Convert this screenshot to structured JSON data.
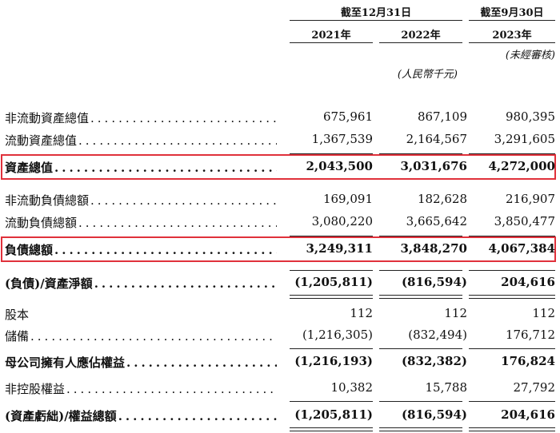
{
  "header": {
    "group_a": "截至12月31日",
    "group_b": "截至9月30日",
    "years": [
      "2021年",
      "2022年",
      "2023年"
    ],
    "unaudited": "(未經審核)",
    "unit": "(人民幣千元)"
  },
  "rows": [
    {
      "label": "非流動資產總值",
      "v": [
        "675,961",
        "867,109",
        "980,395"
      ]
    },
    {
      "label": "流動資產總值",
      "v": [
        "1,367,539",
        "2,164,567",
        "3,291,605"
      ]
    },
    {
      "label": "資產總值",
      "v": [
        "2,043,500",
        "3,031,676",
        "4,272,000"
      ]
    },
    {
      "label": "非流動負債總額",
      "v": [
        "169,091",
        "182,628",
        "216,907"
      ]
    },
    {
      "label": "流動負債總額",
      "v": [
        "3,080,220",
        "3,665,642",
        "3,850,477"
      ]
    },
    {
      "label": "負債總額",
      "v": [
        "3,249,311",
        "3,848,270",
        "4,067,384"
      ]
    },
    {
      "label": "(負債)/資產淨額",
      "v": [
        "(1,205,811)",
        "(816,594)",
        "204,616"
      ]
    },
    {
      "label": "股本",
      "v": [
        "112",
        "112",
        "112"
      ]
    },
    {
      "label": "儲備",
      "v": [
        "(1,216,305)",
        "(832,494)",
        "176,712"
      ]
    },
    {
      "label": "母公司擁有人應佔權益",
      "v": [
        "(1,216,193)",
        "(832,382)",
        "176,824"
      ]
    },
    {
      "label": "非控股權益",
      "v": [
        "10,382",
        "15,788",
        "27,792"
      ]
    },
    {
      "label": "(資產虧絀)/權益總額",
      "v": [
        "(1,205,811)",
        "(816,594)",
        "204,616"
      ]
    }
  ],
  "highlight_color": "#e0313b"
}
